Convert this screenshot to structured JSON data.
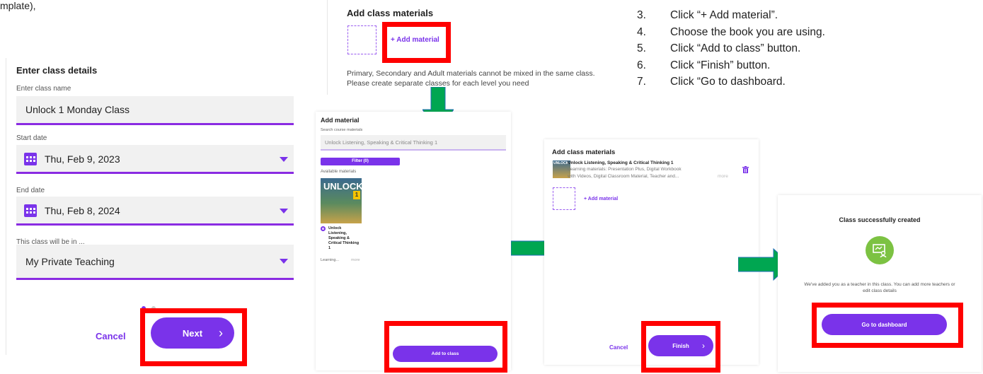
{
  "top_partial": "mplate),",
  "panel1": {
    "title": "Enter class details",
    "class_name_label": "Enter class name",
    "class_name_value": "Unlock 1 Monday Class",
    "start_label": "Start date",
    "start_value": "Thu, Feb 9, 2023",
    "end_label": "End date",
    "end_value": "Thu, Feb 8, 2024",
    "location_label": "This class will be in ...",
    "location_value": "My Private Teaching",
    "cancel_label": "Cancel",
    "next_label": "Next",
    "next_chevron": "›"
  },
  "panel2": {
    "title": "Add class materials",
    "add_material": "+ Add material",
    "note_line1": "Primary, Secondary and Adult materials cannot be mixed in the same class.",
    "note_line2": "Please create separate classes for each level you need"
  },
  "panel3": {
    "title": "Add material",
    "search_label": "Search course materials",
    "search_value": "Unlock Listening, Speaking & Critical Thinking 1",
    "filter_label": "Filter (0)",
    "available_label": "Available materials",
    "cover_text": "UNLOCK",
    "cover_badge": "1",
    "book_title_lines": [
      "Unlock",
      "Listening,",
      "Speaking &",
      "Critical Thinking",
      "1"
    ],
    "learning_label": "Learning...",
    "more_label": "more",
    "add_to_class_label": "Add to class"
  },
  "panel4": {
    "title": "Add class materials",
    "book_title": "Unlock Listening, Speaking & Critical Thinking 1",
    "book_desc_line1": "Learning materials: Presentation Plus, Digital Workbook",
    "book_desc_line2": "with Videos, Digital Classroom Material, Teacher and...",
    "more_label": "more",
    "cover_text": "UNLOCK",
    "add_material": "+ Add material",
    "cancel_label": "Cancel",
    "finish_label": "Finish",
    "finish_chevron": "›"
  },
  "panel5": {
    "title": "Class successfully created",
    "message_line1": "We've added you as a teacher in this class. You can add more teachers or",
    "message_line2": "edit class details",
    "dashboard_label": "Go to dashboard"
  },
  "steps": [
    {
      "num": "3.",
      "text": "Click “+ Add material”."
    },
    {
      "num": "4.",
      "text": "Choose the book you are using."
    },
    {
      "num": "5.",
      "text": "Click “Add to class” button."
    },
    {
      "num": "6.",
      "text": "Click “Finish” button."
    },
    {
      "num": "7.",
      "text": "Click “Go to dashboard."
    }
  ],
  "colors": {
    "accent": "#7a33ea",
    "arrow": "#00a651",
    "highlight": "#ff0000"
  },
  "icons": [
    "calendar-icon",
    "dropdown-caret-icon",
    "trash-icon",
    "teacher-screen-icon",
    "down-arrow-icon",
    "right-arrow-icon"
  ]
}
